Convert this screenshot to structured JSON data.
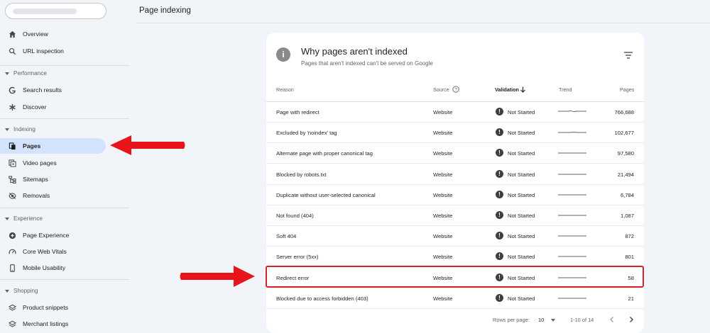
{
  "header": {
    "title": "Page indexing"
  },
  "sidebar": {
    "items": [
      {
        "label": "Overview",
        "icon": "home-icon"
      },
      {
        "label": "URL inspection",
        "icon": "search-icon"
      },
      {
        "label": "Search results",
        "icon": "google-g-icon"
      },
      {
        "label": "Discover",
        "icon": "asterisk-icon"
      },
      {
        "label": "Pages",
        "icon": "pages-icon"
      },
      {
        "label": "Video pages",
        "icon": "video-pages-icon"
      },
      {
        "label": "Sitemaps",
        "icon": "sitemap-icon"
      },
      {
        "label": "Removals",
        "icon": "removals-icon"
      },
      {
        "label": "Page Experience",
        "icon": "page-experience-icon"
      },
      {
        "label": "Core Web Vitals",
        "icon": "speedometer-icon"
      },
      {
        "label": "Mobile Usability",
        "icon": "phone-icon"
      },
      {
        "label": "Product snippets",
        "icon": "layers-icon"
      },
      {
        "label": "Merchant listings",
        "icon": "layers-icon"
      }
    ],
    "sections": [
      "Performance",
      "Indexing",
      "Experience",
      "Shopping"
    ]
  },
  "card": {
    "title": "Why pages aren't indexed",
    "subtitle": "Pages that aren't indexed can't be served on Google",
    "columns": {
      "reason": "Reason",
      "source": "Source",
      "validation": "Validation",
      "trend": "Trend",
      "pages": "Pages"
    },
    "rows": [
      {
        "reason": "Page with redirect",
        "source": "Website",
        "validation": "Not Started",
        "pages": "766,688"
      },
      {
        "reason": "Excluded by 'noindex' tag",
        "source": "Website",
        "validation": "Not Started",
        "pages": "102,677"
      },
      {
        "reason": "Alternate page with proper canonical tag",
        "source": "Website",
        "validation": "Not Started",
        "pages": "97,580"
      },
      {
        "reason": "Blocked by robots.txt",
        "source": "Website",
        "validation": "Not Started",
        "pages": "21,494"
      },
      {
        "reason": "Duplicate without user-selected canonical",
        "source": "Website",
        "validation": "Not Started",
        "pages": "6,784"
      },
      {
        "reason": "Not found (404)",
        "source": "Website",
        "validation": "Not Started",
        "pages": "1,087"
      },
      {
        "reason": "Soft 404",
        "source": "Website",
        "validation": "Not Started",
        "pages": "872"
      },
      {
        "reason": "Server error (5xx)",
        "source": "Website",
        "validation": "Not Started",
        "pages": "801"
      },
      {
        "reason": "Redirect error",
        "source": "Website",
        "validation": "Not Started",
        "pages": "58"
      },
      {
        "reason": "Blocked due to access forbidden (403)",
        "source": "Website",
        "validation": "Not Started",
        "pages": "21"
      }
    ],
    "pagination": {
      "rows_label": "Rows per page:",
      "rows_value": "10",
      "range": "1-10 of 14"
    }
  },
  "colors": {
    "accent": "#d3e3fd",
    "highlight": "#d8222b",
    "arrow": "#e8141c"
  }
}
